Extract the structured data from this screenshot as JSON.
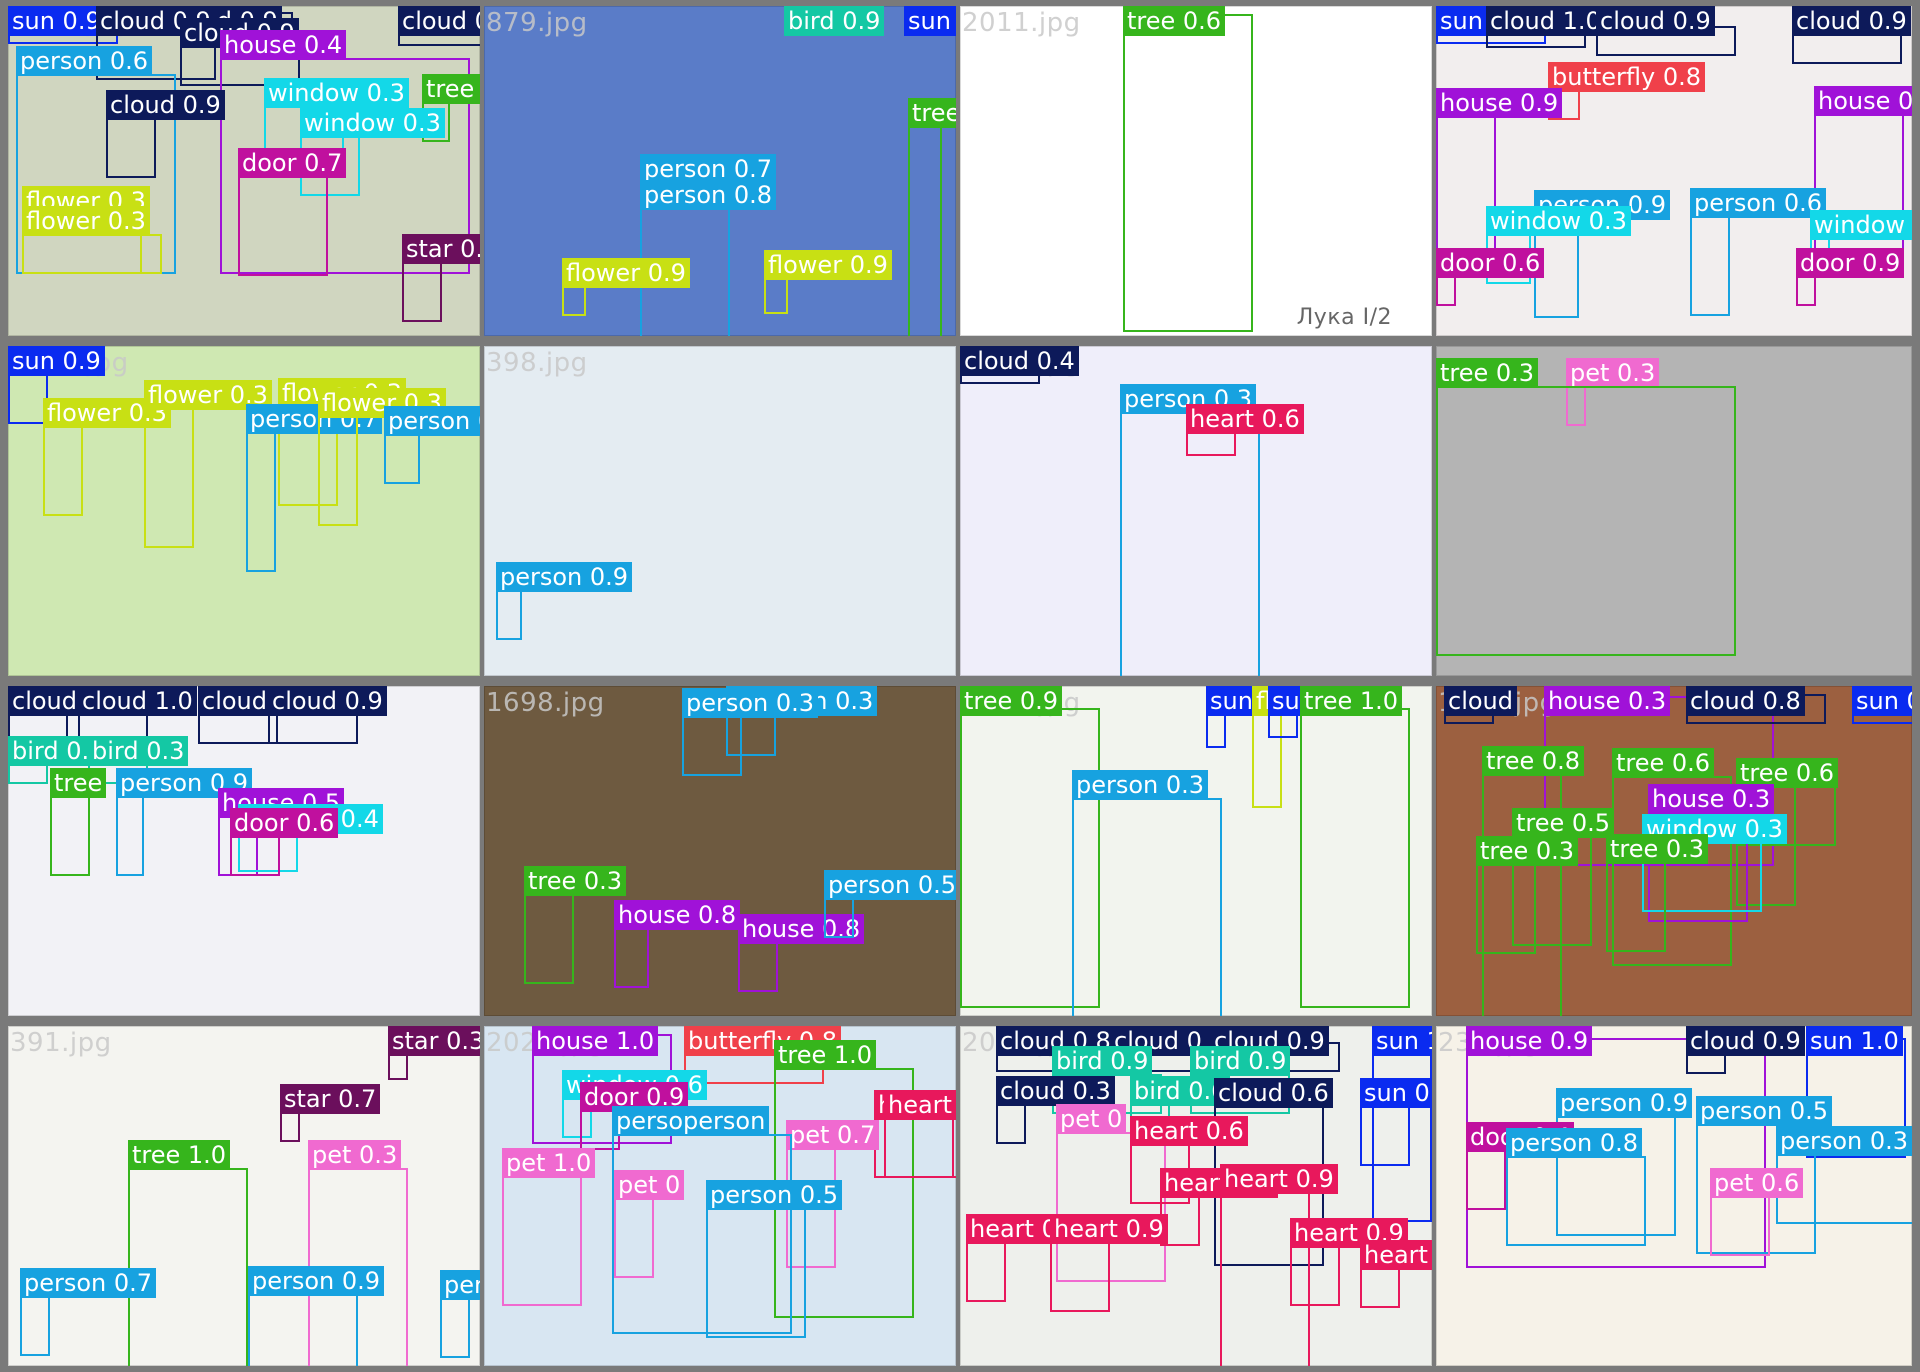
{
  "classes": {
    "person": "#17a2e0",
    "sun": "#0a2bf0",
    "cloud": "#0d1a5a",
    "house": "#a012d8",
    "window": "#13d8e8",
    "tree": "#36b51c",
    "door": "#c0109e",
    "flower": "#c8e014",
    "star": "#6b0f5c",
    "bird": "#14c8a4",
    "butterfly": "#f0404a",
    "heart": "#e8185c",
    "pet": "#f06ad0"
  },
  "tile_colors": [
    "#d0d6c0",
    "#5a7cc8",
    "#ffffff",
    "#f2eeee",
    "#cfe8b2",
    "#e4ecf2",
    "#efeefa",
    "#b4b4b4",
    "#f2f2f6",
    "#6e5a40",
    "#f2f4ee",
    "#9c6040",
    "#f4f4f0",
    "#d8e6f2",
    "#eef0ec",
    "#f6f2e8"
  ],
  "tiles": [
    {
      "name": "1757.jpg",
      "color_class": "person",
      "dets": [
        [
          "sun",
          "sun 0.9"
        ],
        [
          "cloud",
          "cloud 0.9"
        ],
        [
          "cloud",
          "cloud 0.9"
        ],
        [
          "cloud",
          "cloud 0.9"
        ],
        [
          "house",
          "house 0.4"
        ],
        [
          "cloud",
          "cloud 0.9"
        ],
        [
          "person",
          "person 0.6"
        ],
        [
          "window",
          "window 0.3"
        ],
        [
          "tree",
          "tree 0.7"
        ],
        [
          "cloud",
          "cloud 0.9"
        ],
        [
          "window",
          "window 0.3"
        ],
        [
          "door",
          "door 0.7"
        ],
        [
          "flower",
          "flower 0.3"
        ],
        [
          "flower",
          "flower 0.3"
        ],
        [
          "star",
          "star 0.4"
        ]
      ]
    },
    {
      "name": "879.jpg",
      "dets": [
        [
          "bird",
          "bird 0.9"
        ],
        [
          "sun",
          "sun 0.9"
        ],
        [
          "tree",
          "tree 0.9"
        ],
        [
          "person",
          "person 0.7"
        ],
        [
          "person",
          "person 0.8"
        ],
        [
          "flower",
          "flower 0.9"
        ],
        [
          "flower",
          "flower 0.9"
        ]
      ]
    },
    {
      "name": "2011.jpg",
      "dets": [
        [
          "tree",
          "tree 0.6"
        ]
      ],
      "text": [
        "Лука I/2"
      ]
    },
    {
      "name": "",
      "dets": [
        [
          "sun",
          "sun 0.9"
        ],
        [
          "cloud",
          "cloud 1.0"
        ],
        [
          "cloud",
          "cloud 0.9"
        ],
        [
          "cloud",
          "cloud 0.9"
        ],
        [
          "butterfly",
          "butterfly 0.8"
        ],
        [
          "house",
          "house 0.9"
        ],
        [
          "house",
          "house 0.9"
        ],
        [
          "person",
          "person 0.9"
        ],
        [
          "person",
          "person 0.6"
        ],
        [
          "window",
          "window 0.3"
        ],
        [
          "window",
          "window 0.4"
        ],
        [
          "door",
          "door 0.6"
        ],
        [
          "door",
          "door 0.9"
        ]
      ]
    },
    {
      "name": "1105.jpg",
      "dets": [
        [
          "sun",
          "sun 0.9"
        ],
        [
          "flower",
          "flower 0.3"
        ],
        [
          "flower",
          "flower 0.3"
        ],
        [
          "flower",
          "flower 0.3"
        ],
        [
          "person",
          "person 0.7"
        ],
        [
          "flower",
          "flower 0.3"
        ],
        [
          "person",
          "person 0.4"
        ]
      ]
    },
    {
      "name": "398.jpg",
      "dets": [
        [
          "person",
          "person 0.9"
        ]
      ]
    },
    {
      "name": "2022.jpg",
      "dets": [
        [
          "cloud",
          "cloud 0.4"
        ],
        [
          "person",
          "person 0.3"
        ],
        [
          "heart",
          "heart 0.6"
        ]
      ]
    },
    {
      "name": "",
      "dets": [
        [
          "pet",
          "pet 0.3"
        ],
        [
          "tree",
          "tree 0.3"
        ]
      ]
    },
    {
      "name": "",
      "dets": [
        [
          "cloud",
          "cloud 0.7"
        ],
        [
          "cloud",
          "cloud 1.0"
        ],
        [
          "cloud",
          "cloud 1.0"
        ],
        [
          "cloud",
          "cloud 0.9"
        ],
        [
          "bird",
          "bird 0.3"
        ],
        [
          "bird",
          "bird 0.3"
        ],
        [
          "tree",
          "tree"
        ],
        [
          "person",
          "person 0.9"
        ],
        [
          "house",
          "house 0.5"
        ],
        [
          "window",
          "window 0.4"
        ],
        [
          "door",
          "door 0.6"
        ]
      ]
    },
    {
      "name": "1698.jpg",
      "dets": [
        [
          "person",
          "pperson 0.3"
        ],
        [
          "person",
          "person 0.3"
        ],
        [
          "tree",
          "tree 0.3"
        ],
        [
          "house",
          "house 0.8"
        ],
        [
          "house",
          "house 0.8"
        ],
        [
          "person",
          "person 0.5"
        ]
      ]
    },
    {
      "name": "2024.jpg",
      "dets": [
        [
          "tree",
          "tree 0.9"
        ],
        [
          "sun",
          "sun"
        ],
        [
          "flower",
          "flo"
        ],
        [
          "sun",
          "sun 0.3"
        ],
        [
          "tree",
          "tree 1.0"
        ],
        [
          "person",
          "person 0.3"
        ]
      ]
    },
    {
      "name": "1713.jpg",
      "dets": [
        [
          "cloud",
          "cloud"
        ],
        [
          "house",
          "house 0.3"
        ],
        [
          "cloud",
          "cloud 0.8"
        ],
        [
          "sun",
          "sun 0.9"
        ],
        [
          "tree",
          "tree 0.8"
        ],
        [
          "tree",
          "tree 0.6"
        ],
        [
          "tree",
          "tree 0.5"
        ],
        [
          "tree",
          "tree 0.6"
        ],
        [
          "house",
          "house 0.3"
        ],
        [
          "tree",
          "tree 0.5"
        ],
        [
          "window",
          "window 0.3"
        ],
        [
          "tree",
          "tree 0.3"
        ],
        [
          "tree",
          "tree 0.3"
        ]
      ]
    },
    {
      "name": "391.jpg",
      "dets": [
        [
          "star",
          "star 0.3"
        ],
        [
          "star",
          "star 0.7"
        ],
        [
          "tree",
          "tree 1.0"
        ],
        [
          "pet",
          "pet 0.3"
        ],
        [
          "person",
          "person 0.7"
        ],
        [
          "person",
          "person 0.9"
        ],
        [
          "person",
          "person 0.9"
        ]
      ]
    },
    {
      "name": "2021.jpg",
      "dets": [
        [
          "house",
          "house 1.0"
        ],
        [
          "butterfly",
          "butterfly 0.8"
        ],
        [
          "tree",
          "tree 1.0"
        ],
        [
          "window",
          "window 0.6"
        ],
        [
          "door",
          "door 0.9"
        ],
        [
          "heart",
          "heart 0.3"
        ],
        [
          "heart",
          "heart 0.3"
        ],
        [
          "pet",
          "pet 0.7"
        ],
        [
          "person",
          "persoperson"
        ],
        [
          "pet",
          "pet 1.0"
        ],
        [
          "pet",
          "pet 0"
        ],
        [
          "person",
          "person 0.5"
        ]
      ]
    },
    {
      "name": "2025.jpg",
      "dets": [
        [
          "cloud",
          "cloud 0.8"
        ],
        [
          "cloud",
          "cloud 0.8"
        ],
        [
          "cloud",
          "cloud 0.9"
        ],
        [
          "bird",
          "bird 0.9"
        ],
        [
          "bird",
          "bird 0.9"
        ],
        [
          "sun",
          "sun 1.0"
        ],
        [
          "cloud",
          "cloud 0.3"
        ],
        [
          "bird",
          "bird 0.6"
        ],
        [
          "cloud",
          "cloud 0.6"
        ],
        [
          "sun",
          "sun 0.3"
        ],
        [
          "pet",
          "pet 0"
        ],
        [
          "heart",
          "heart 0.6"
        ],
        [
          "heart",
          "heart 0.9"
        ],
        [
          "heart",
          "heart 0.9"
        ],
        [
          "heart",
          "heart 0.8"
        ],
        [
          "heart",
          "heart 0.9"
        ],
        [
          "heart",
          "heart 0.9"
        ],
        [
          "heart",
          "heart"
        ]
      ]
    },
    {
      "name": "235.jpg",
      "dets": [
        [
          "house",
          "house 0.9"
        ],
        [
          "cloud",
          "cloud 0.9"
        ],
        [
          "sun",
          "sun 1.0"
        ],
        [
          "person",
          "person 0.9"
        ],
        [
          "person",
          "person 0.5"
        ],
        [
          "door",
          "door 0.4"
        ],
        [
          "person",
          "person 0.8"
        ],
        [
          "person",
          "person 0.3"
        ],
        [
          "pet",
          "pet 0.6"
        ]
      ]
    }
  ]
}
